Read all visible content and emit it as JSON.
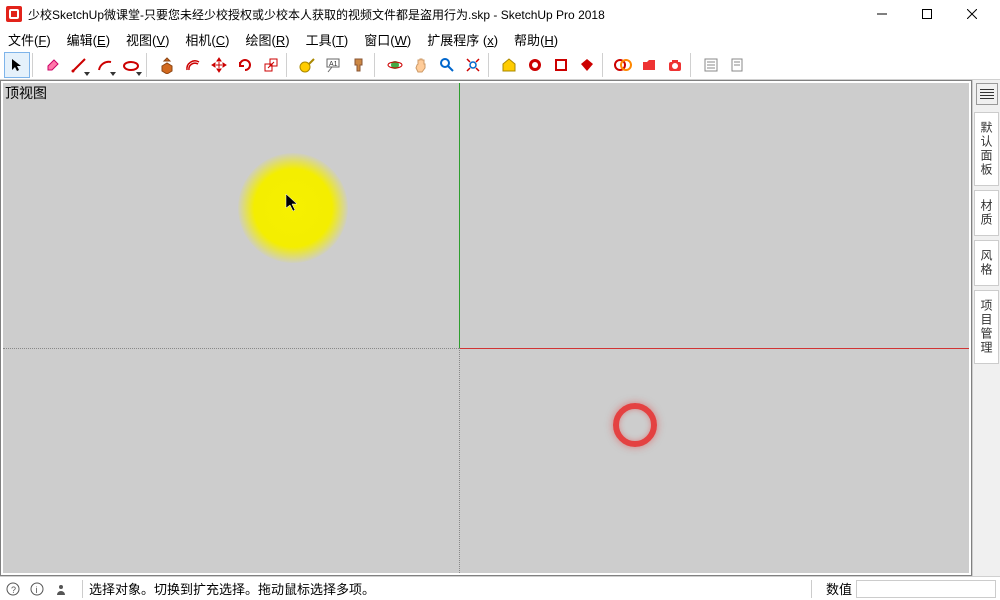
{
  "titlebar": {
    "title": "少校SketchUp微课堂-只要您未经少校授权或少校本人获取的视频文件都是盗用行为.skp - SketchUp Pro 2018"
  },
  "menus": {
    "file": {
      "label": "文件",
      "key": "F"
    },
    "edit": {
      "label": "编辑",
      "key": "E"
    },
    "view": {
      "label": "视图",
      "key": "V"
    },
    "camera": {
      "label": "相机",
      "key": "C"
    },
    "draw": {
      "label": "绘图",
      "key": "R"
    },
    "tools": {
      "label": "工具",
      "key": "T"
    },
    "window": {
      "label": "窗口",
      "key": "W"
    },
    "extensions": {
      "label": "扩展程序",
      "key": "x"
    },
    "help": {
      "label": "帮助",
      "key": "H"
    }
  },
  "viewport": {
    "label": "顶视图"
  },
  "tray": {
    "tabs": [
      "默认面板",
      "材质",
      "风格",
      "项目管理"
    ]
  },
  "status": {
    "hint": "选择对象。切换到扩充选择。拖动鼠标选择多项。",
    "value_label": "数值",
    "value": ""
  },
  "tools": {
    "select": "select",
    "eraser": "eraser",
    "line": "line",
    "arc": "arc",
    "shape": "shape",
    "pushpull": "pushpull",
    "offset": "offset",
    "move": "move",
    "rotate": "rotate",
    "scale": "scale",
    "tape": "tape",
    "text": "text",
    "paint": "paint",
    "orbit": "orbit",
    "pan": "pan",
    "zoom": "zoom",
    "zoomext": "zoomext",
    "section": "section",
    "3dwh": "3dwh",
    "ext1": "ext1",
    "ext2": "ext2",
    "ext3": "ext3",
    "ext4": "ext4",
    "ext5": "ext5",
    "ext6": "ext6",
    "ext7": "ext7",
    "ext8": "ext8"
  }
}
